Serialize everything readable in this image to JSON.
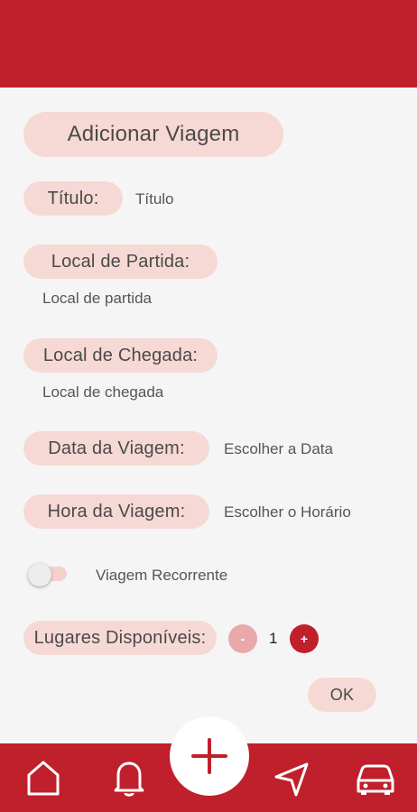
{
  "form": {
    "title": "Adicionar Viagem",
    "titulo_label": "Título:",
    "titulo_placeholder": "Título",
    "partida_label": "Local de Partida:",
    "partida_placeholder": "Local de partida",
    "chegada_label": "Local de Chegada:",
    "chegada_placeholder": "Local de chegada",
    "data_label": "Data da Viagem:",
    "data_value": "Escolher a Data",
    "hora_label": "Hora da Viagem:",
    "hora_value": "Escolher o Horário",
    "recorrente_label": "Viagem Recorrente",
    "recorrente_on": false,
    "lugares_label": "Lugares Disponíveis:",
    "lugares_minus": "-",
    "lugares_value": "1",
    "lugares_plus": "+",
    "ok_label": "OK"
  },
  "colors": {
    "primary": "#c01f2c",
    "pill": "#f6d9d4",
    "background": "#f5f5f5"
  },
  "nav": {
    "icons": [
      "home-icon",
      "bell-icon",
      "plus-icon",
      "navigation-arrow-icon",
      "car-icon"
    ]
  }
}
